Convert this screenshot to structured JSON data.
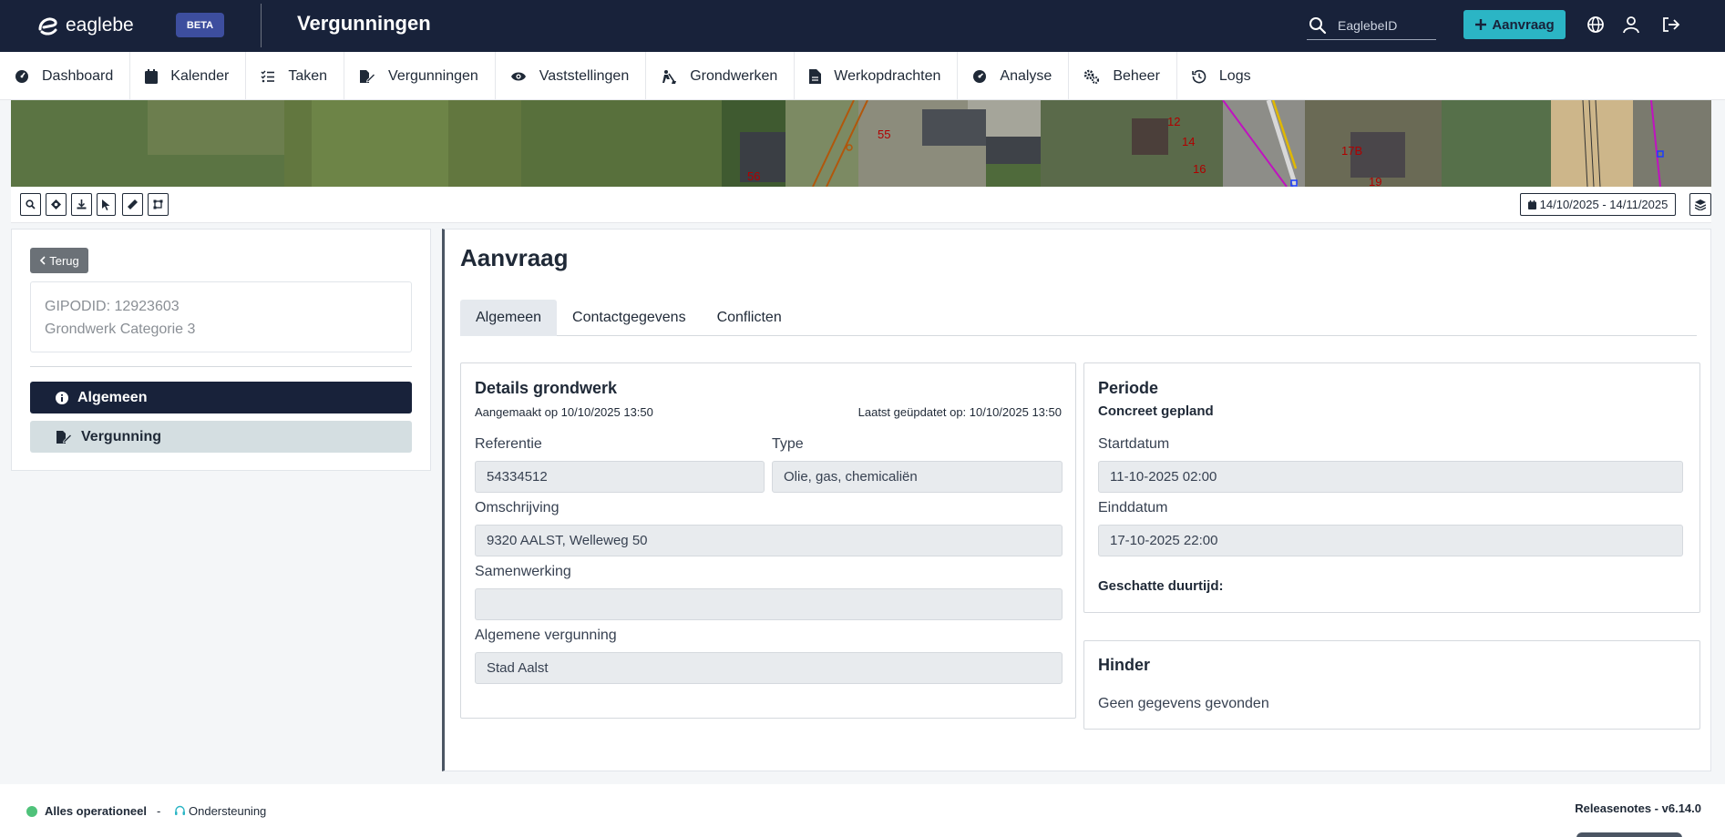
{
  "topbar": {
    "logo_text": "eaglebe",
    "beta_label": "BETA",
    "app_title": "Vergunningen",
    "search_placeholder": "EaglebeID",
    "new_button_label": "Aanvraag"
  },
  "nav": {
    "items": [
      {
        "label": "Dashboard",
        "icon": "dashboard-icon"
      },
      {
        "label": "Kalender",
        "icon": "calendar-icon"
      },
      {
        "label": "Taken",
        "icon": "tasks-icon"
      },
      {
        "label": "Vergunningen",
        "icon": "permit-icon"
      },
      {
        "label": "Vaststellingen",
        "icon": "eye-icon"
      },
      {
        "label": "Grondwerken",
        "icon": "digging-icon"
      },
      {
        "label": "Werkopdrachten",
        "icon": "document-icon"
      },
      {
        "label": "Analyse",
        "icon": "analysis-icon"
      },
      {
        "label": "Beheer",
        "icon": "cogs-icon"
      },
      {
        "label": "Logs",
        "icon": "history-icon"
      }
    ]
  },
  "map": {
    "parcel_labels": [
      "55",
      "56",
      "12",
      "14",
      "16",
      "17B",
      "19"
    ],
    "date_range": "14/10/2025 - 14/11/2025"
  },
  "sidebar": {
    "back_label": "Terug",
    "gipod_id": "GIPODID: 12923603",
    "category": "Grondwerk Categorie 3",
    "items": [
      {
        "label": "Algemeen",
        "icon": "info-icon",
        "active": true
      },
      {
        "label": "Vergunning",
        "icon": "permit-icon",
        "active": false
      }
    ]
  },
  "main": {
    "title": "Aanvraag",
    "tabs": [
      {
        "label": "Algemeen",
        "active": true
      },
      {
        "label": "Contactgegevens",
        "active": false
      },
      {
        "label": "Conflicten",
        "active": false
      }
    ],
    "details": {
      "title": "Details grondwerk",
      "created": "Aangemaakt op 10/10/2025 13:50",
      "updated": "Laatst geüpdatet op: 10/10/2025 13:50",
      "referentie_label": "Referentie",
      "referentie_value": "54334512",
      "type_label": "Type",
      "type_value": "Olie, gas, chemicaliën",
      "omschrijving_label": "Omschrijving",
      "omschrijving_value": "9320 AALST, Welleweg 50",
      "samenwerking_label": "Samenwerking",
      "samenwerking_value": "",
      "vergunning_label": "Algemene vergunning",
      "vergunning_value": "Stad Aalst"
    },
    "periode": {
      "title": "Periode",
      "subtitle": "Concreet gepland",
      "start_label": "Startdatum",
      "start_value": "11-10-2025 02:00",
      "end_label": "Einddatum",
      "end_value": "17-10-2025 22:00",
      "duration_label": "Geschatte duurtijd:"
    },
    "hinder": {
      "title": "Hinder",
      "empty_text": "Geen gegevens gevonden"
    }
  },
  "footer": {
    "status": "Alles operationeel",
    "separator": "-",
    "support": "Ondersteuning",
    "release": "Releasenotes - v6.14.0"
  },
  "colors": {
    "header_bg": "#18223a",
    "accent": "#2bb5c5",
    "beta_bg": "#3d4e9e",
    "status_ok": "#4fc27a"
  }
}
